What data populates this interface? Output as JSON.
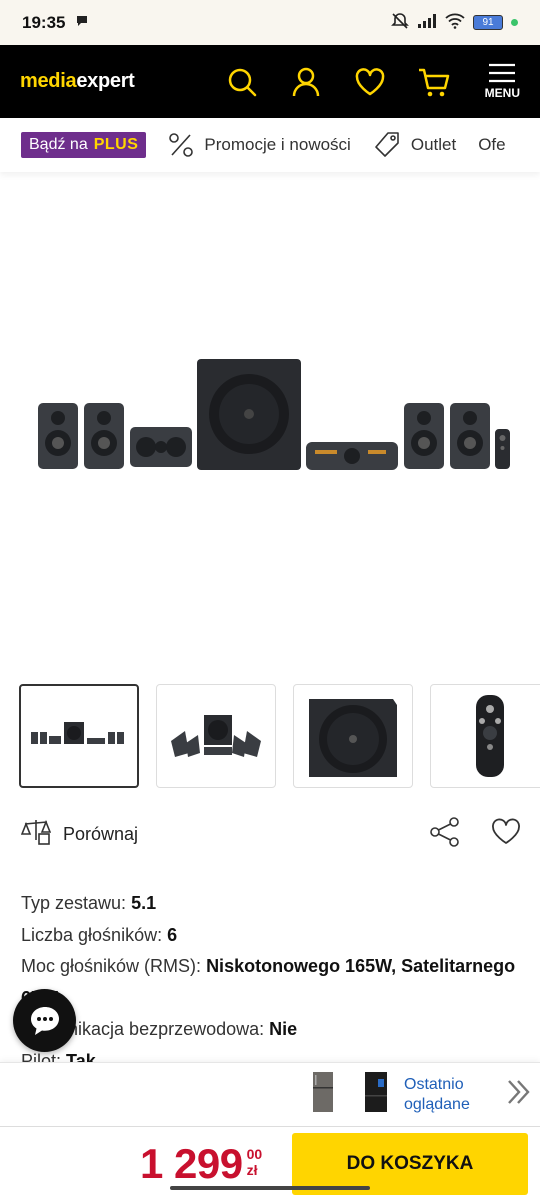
{
  "status_bar": {
    "time": "19:35",
    "battery": "91"
  },
  "header": {
    "logo_part1": "media",
    "logo_part2": "expert",
    "menu_label": "MENU",
    "icons": [
      "search-icon",
      "user-icon",
      "heart-icon",
      "cart-icon",
      "menu-icon"
    ]
  },
  "categories": {
    "plus_prefix": "Bądź na",
    "plus_word": "PLUS",
    "items": [
      "Promocje i nowości",
      "Outlet",
      "Ofe"
    ]
  },
  "product": {
    "compare_label": "Porównaj",
    "specs": [
      {
        "label": "Typ zestawu:",
        "value": "5.1"
      },
      {
        "label": "Liczba głośników:",
        "value": "6"
      },
      {
        "label": "Moc głośników (RMS):",
        "value": "Niskotonowego 165W, Satelitarnego 67W"
      },
      {
        "label": "Komunikacja bezprzewodowa:",
        "value": "Nie"
      },
      {
        "label": "Pilot:",
        "value": "Tak"
      }
    ]
  },
  "recent": {
    "label_line1": "Ostatnio",
    "label_line2": "oglądane"
  },
  "purchase": {
    "price_main": "1 299",
    "price_cents": "00",
    "currency": "zł",
    "cart_label": "DO KOSZYKA"
  }
}
